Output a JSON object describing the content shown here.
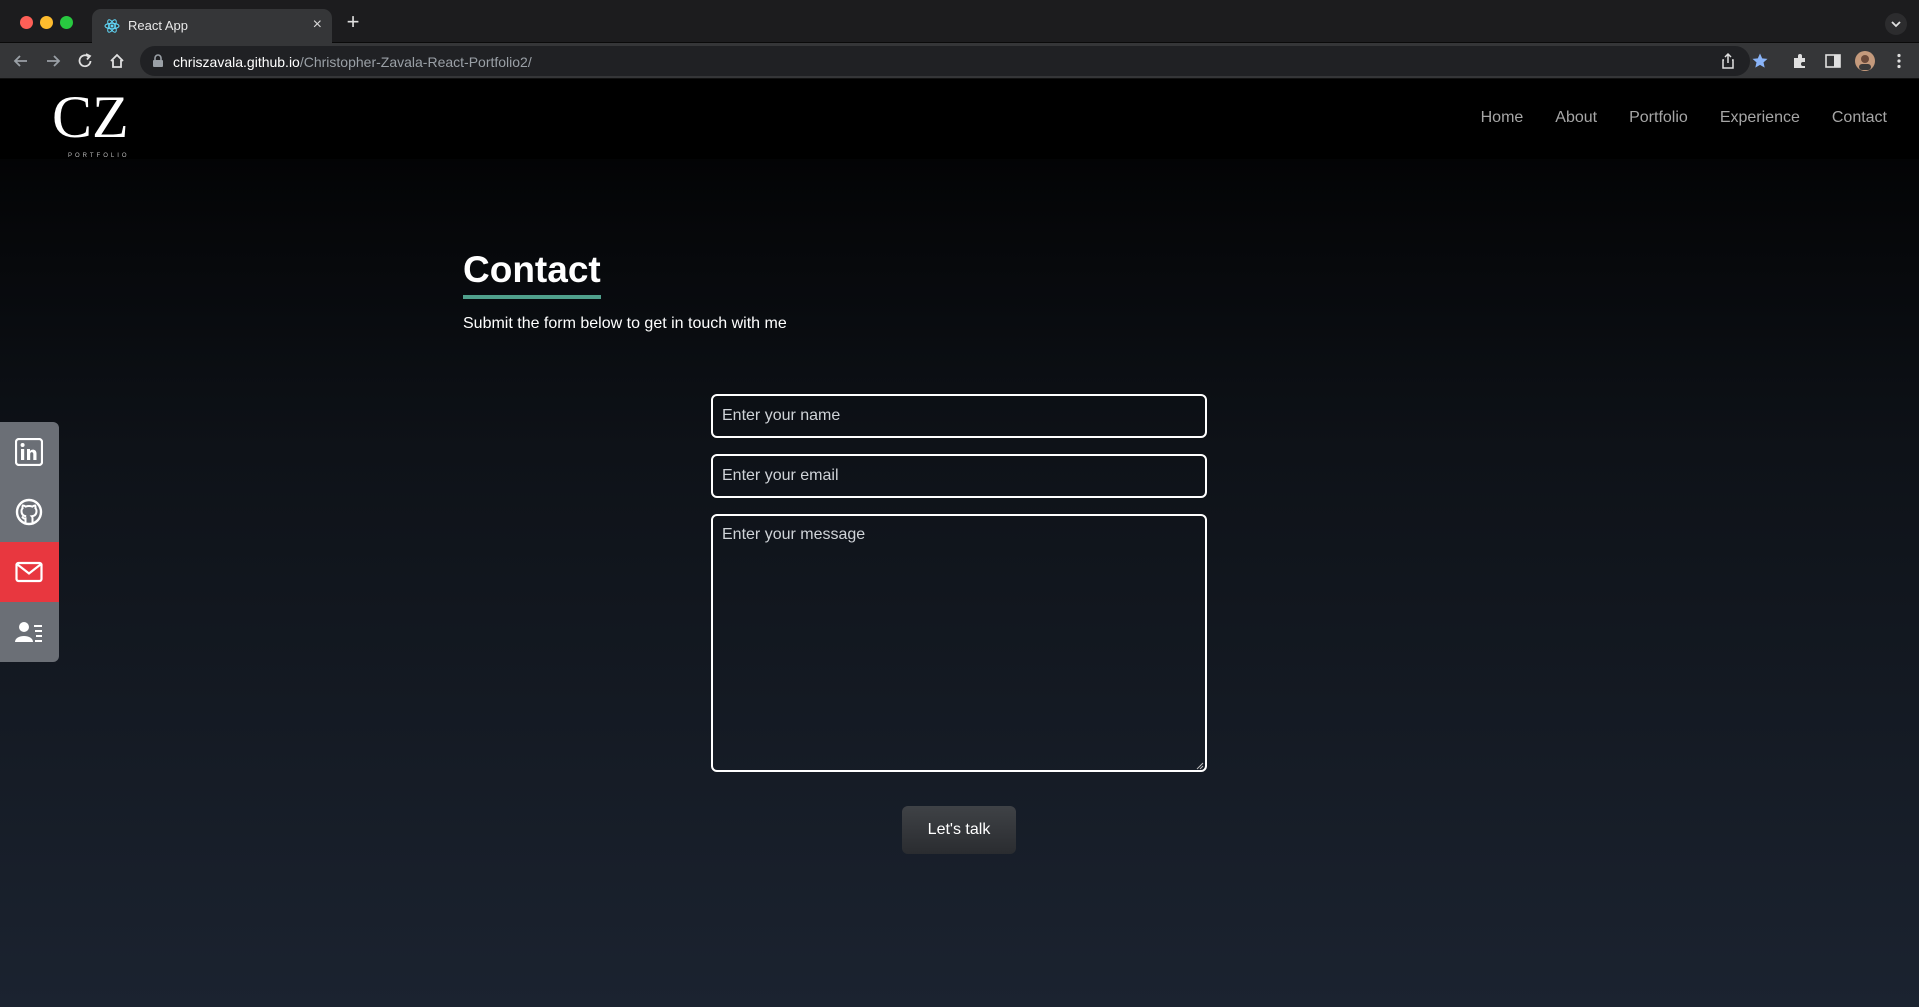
{
  "browser": {
    "tab_title": "React App",
    "tab_close": "×",
    "new_tab": "+",
    "url_host": "chriszavala.github.io",
    "url_path": "/Christopher-Zavala-React-Portfolio2/"
  },
  "navbar": {
    "logo_text": "CZ",
    "logo_subtext": "PORTFOLIO",
    "links": [
      "Home",
      "About",
      "Portfolio",
      "Experience",
      "Contact"
    ]
  },
  "contact": {
    "heading": "Contact",
    "subtext": "Submit the form below to get in touch with me",
    "name_placeholder": "Enter your name",
    "email_placeholder": "Enter your email",
    "message_placeholder": "Enter your message",
    "submit_label": "Let's talk"
  },
  "social": {
    "items": [
      "linkedin-icon",
      "github-icon",
      "mail-icon",
      "resume-icon"
    ],
    "highlight_color": "#e8373f",
    "base_color": "#6b6f76"
  },
  "colors": {
    "heading_underline": "#4fa08c"
  }
}
